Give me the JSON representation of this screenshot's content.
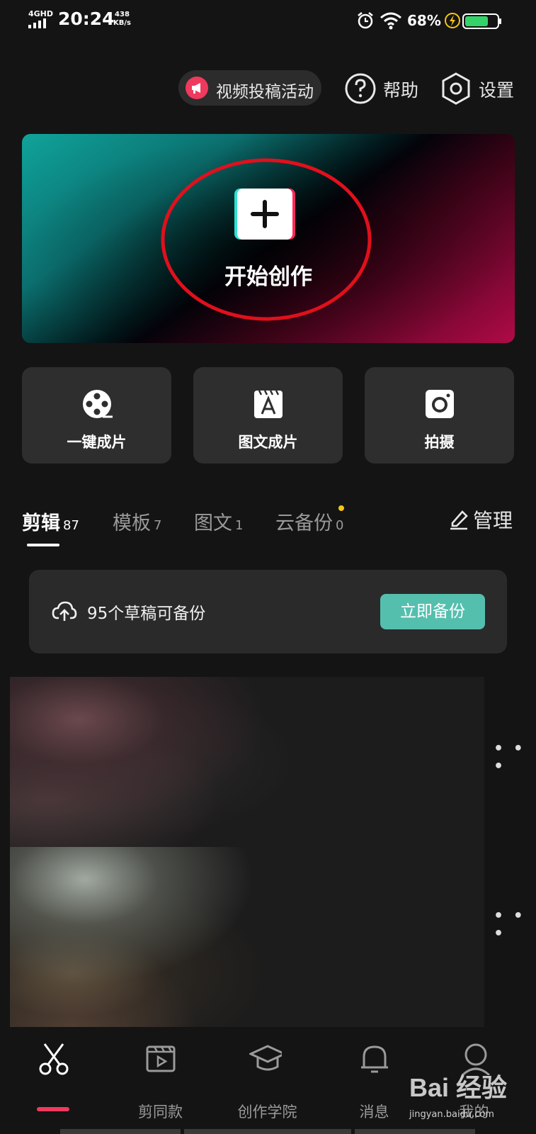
{
  "status_bar": {
    "network": "4GHD",
    "time": "20:24",
    "speed_value": "438",
    "speed_unit": "KB/s",
    "battery": "68%"
  },
  "top_actions": {
    "campaign": "视频投稿活动",
    "help": "帮助",
    "settings": "设置"
  },
  "hero": {
    "label": "开始创作"
  },
  "tiles": [
    {
      "label": "一键成片",
      "icon": "film-reel-icon"
    },
    {
      "label": "图文成片",
      "icon": "text-card-icon"
    },
    {
      "label": "拍摄",
      "icon": "camera-icon"
    }
  ],
  "tabs": [
    {
      "label": "剪辑",
      "count": "87",
      "active": true
    },
    {
      "label": "模板",
      "count": "7"
    },
    {
      "label": "图文",
      "count": "1"
    },
    {
      "label": "云备份",
      "count": "0",
      "badge": true
    }
  ],
  "manage": "管理",
  "backup": {
    "text": "95个草稿可备份",
    "button": "立即备份"
  },
  "bottom_nav": [
    {
      "label": "",
      "icon": "scissors-icon",
      "active": true
    },
    {
      "label": "剪同款",
      "icon": "clapper-icon"
    },
    {
      "label": "创作学院",
      "icon": "graduation-cap-icon"
    },
    {
      "label": "消息",
      "icon": "bell-icon"
    },
    {
      "label": "我的",
      "icon": "profile-icon"
    }
  ],
  "watermark": {
    "text": "jingyan.baidu.com",
    "logo_text": "Bai 经验"
  },
  "colors": {
    "accent_red": "#ef3a5d",
    "accent_teal": "#55bfae",
    "badge_yellow": "#f5c518"
  }
}
